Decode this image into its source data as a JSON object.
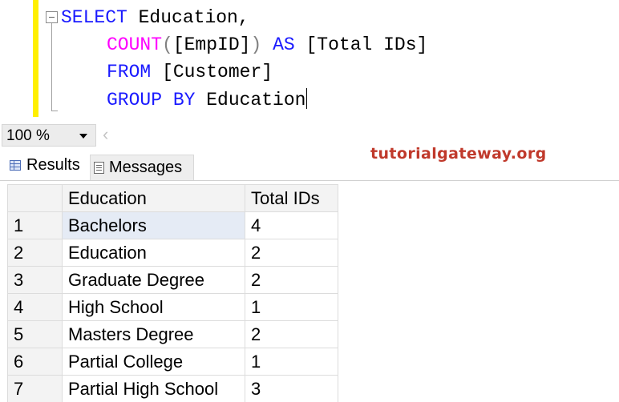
{
  "editor": {
    "lines": [
      {
        "kw1": "SELECT",
        "text1": " Education,"
      },
      {
        "fn": "COUNT",
        "punc1": "(",
        "text": "[EmpID]",
        "punc2": ")",
        "kw": " AS",
        "text2": " [Total IDs]"
      },
      {
        "kw": "FROM",
        "text": " [Customer]"
      },
      {
        "kw": "GROUP BY",
        "text": " Education"
      }
    ],
    "colors": {
      "keyword": "#1a1aff",
      "function": "#ff00ff",
      "margin": "#ffef00"
    }
  },
  "zoom": {
    "value": "100 %"
  },
  "brand": {
    "text": "tutorialgateway.org",
    "color": "#c0392b"
  },
  "tabs": [
    {
      "label": "Results",
      "icon": "results-grid-icon"
    },
    {
      "label": "Messages",
      "icon": "messages-icon"
    }
  ],
  "grid": {
    "headers": [
      "Education",
      "Total IDs"
    ],
    "rows": [
      {
        "num": "1",
        "education": "Bachelors",
        "total": "4"
      },
      {
        "num": "2",
        "education": "Education",
        "total": "2"
      },
      {
        "num": "3",
        "education": "Graduate Degree",
        "total": "2"
      },
      {
        "num": "4",
        "education": "High School",
        "total": "1"
      },
      {
        "num": "5",
        "education": "Masters Degree",
        "total": "2"
      },
      {
        "num": "6",
        "education": "Partial College",
        "total": "1"
      },
      {
        "num": "7",
        "education": "Partial High School",
        "total": "3"
      }
    ]
  }
}
